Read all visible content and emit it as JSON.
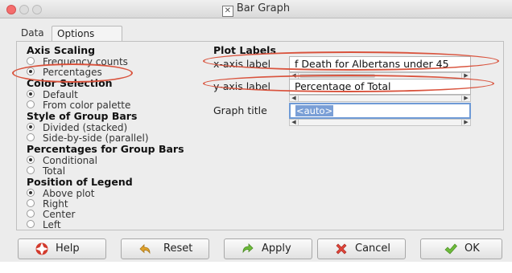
{
  "window": {
    "title": "Bar Graph"
  },
  "tabs": [
    {
      "label": "Data"
    },
    {
      "label": "Options"
    }
  ],
  "axis_scaling": {
    "title": "Axis Scaling",
    "options": [
      {
        "label": "Frequency counts",
        "selected": false
      },
      {
        "label": "Percentages",
        "selected": true
      }
    ]
  },
  "color_selection": {
    "title": "Color Selection",
    "options": [
      {
        "label": "Default",
        "selected": true
      },
      {
        "label": "From color palette",
        "selected": false
      }
    ]
  },
  "group_bar_style": {
    "title": "Style of Group Bars",
    "options": [
      {
        "label": "Divided (stacked)",
        "selected": true
      },
      {
        "label": "Side-by-side (parallel)",
        "selected": false
      }
    ]
  },
  "group_bar_percentages": {
    "title": "Percentages for Group Bars",
    "options": [
      {
        "label": "Conditional",
        "selected": true
      },
      {
        "label": "Total",
        "selected": false
      }
    ]
  },
  "legend_position": {
    "title": "Position of Legend",
    "options": [
      {
        "label": "Above plot",
        "selected": true
      },
      {
        "label": "Right",
        "selected": false
      },
      {
        "label": "Center",
        "selected": false
      },
      {
        "label": "Left",
        "selected": false
      }
    ]
  },
  "plot_labels": {
    "title": "Plot Labels",
    "x_axis_label": "x-axis label",
    "x_axis_value": "f Death for Albertans under 45",
    "y_axis_label": "y-axis label",
    "y_axis_value": "Percentage of Total",
    "graph_title_label": "Graph title",
    "graph_title_value": "<auto>"
  },
  "buttons": {
    "help": "Help",
    "reset": "Reset",
    "apply": "Apply",
    "cancel": "Cancel",
    "ok": "OK"
  },
  "colors": {
    "annotation_red": "#d9533d",
    "focus_blue": "#6e9ad6",
    "close_red": "#f56d6d"
  }
}
